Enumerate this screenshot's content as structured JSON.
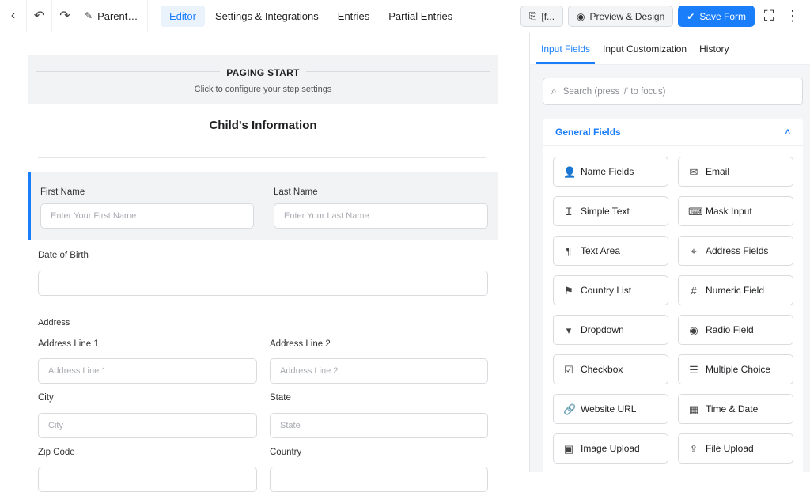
{
  "topbar": {
    "form_title": "Parenta...",
    "tabs": [
      "Editor",
      "Settings & Integrations",
      "Entries",
      "Partial Entries"
    ],
    "shortcode_label": "[f...",
    "preview_label": "Preview & Design",
    "save_label": "Save Form",
    "accent": "#1a7efb"
  },
  "canvas": {
    "paging_title": "PAGING START",
    "paging_sub": "Click to configure your step settings",
    "section_title": "Child's Information",
    "first_name_label": "First Name",
    "first_name_placeholder": "Enter Your First Name",
    "last_name_label": "Last Name",
    "last_name_placeholder": "Enter Your Last Name",
    "dob_label": "Date of Birth",
    "address_label": "Address",
    "addr1_label": "Address Line 1",
    "addr1_placeholder": "Address Line 1",
    "addr2_label": "Address Line 2",
    "addr2_placeholder": "Address Line 2",
    "city_label": "City",
    "city_placeholder": "City",
    "state_label": "State",
    "state_placeholder": "State",
    "zip_label": "Zip Code",
    "country_label": "Country"
  },
  "sidebar": {
    "tabs": [
      "Input Fields",
      "Input Customization",
      "History"
    ],
    "search_placeholder": "Search (press '/' to focus)",
    "group_title": "General Fields",
    "fields": [
      {
        "label": "Name Fields",
        "icon": "user-icon",
        "glyph": "👤"
      },
      {
        "label": "Email",
        "icon": "envelope-icon",
        "glyph": "✉"
      },
      {
        "label": "Simple Text",
        "icon": "text-cursor-icon",
        "glyph": "Ｉ"
      },
      {
        "label": "Mask Input",
        "icon": "keyboard-icon",
        "glyph": "⌨"
      },
      {
        "label": "Text Area",
        "icon": "paragraph-icon",
        "glyph": "¶"
      },
      {
        "label": "Address Fields",
        "icon": "map-pin-icon",
        "glyph": "⌖"
      },
      {
        "label": "Country List",
        "icon": "flag-icon",
        "glyph": "⚑"
      },
      {
        "label": "Numeric Field",
        "icon": "hash-icon",
        "glyph": "#"
      },
      {
        "label": "Dropdown",
        "icon": "dropdown-icon",
        "glyph": "▾"
      },
      {
        "label": "Radio Field",
        "icon": "radio-icon",
        "glyph": "◉"
      },
      {
        "label": "Checkbox",
        "icon": "checkbox-icon",
        "glyph": "☑"
      },
      {
        "label": "Multiple Choice",
        "icon": "list-checks-icon",
        "glyph": "☰"
      },
      {
        "label": "Website URL",
        "icon": "link-icon",
        "glyph": "🔗"
      },
      {
        "label": "Time & Date",
        "icon": "calendar-icon",
        "glyph": "▦"
      },
      {
        "label": "Image Upload",
        "icon": "image-icon",
        "glyph": "▣"
      },
      {
        "label": "File Upload",
        "icon": "upload-icon",
        "glyph": "⇪"
      }
    ]
  }
}
